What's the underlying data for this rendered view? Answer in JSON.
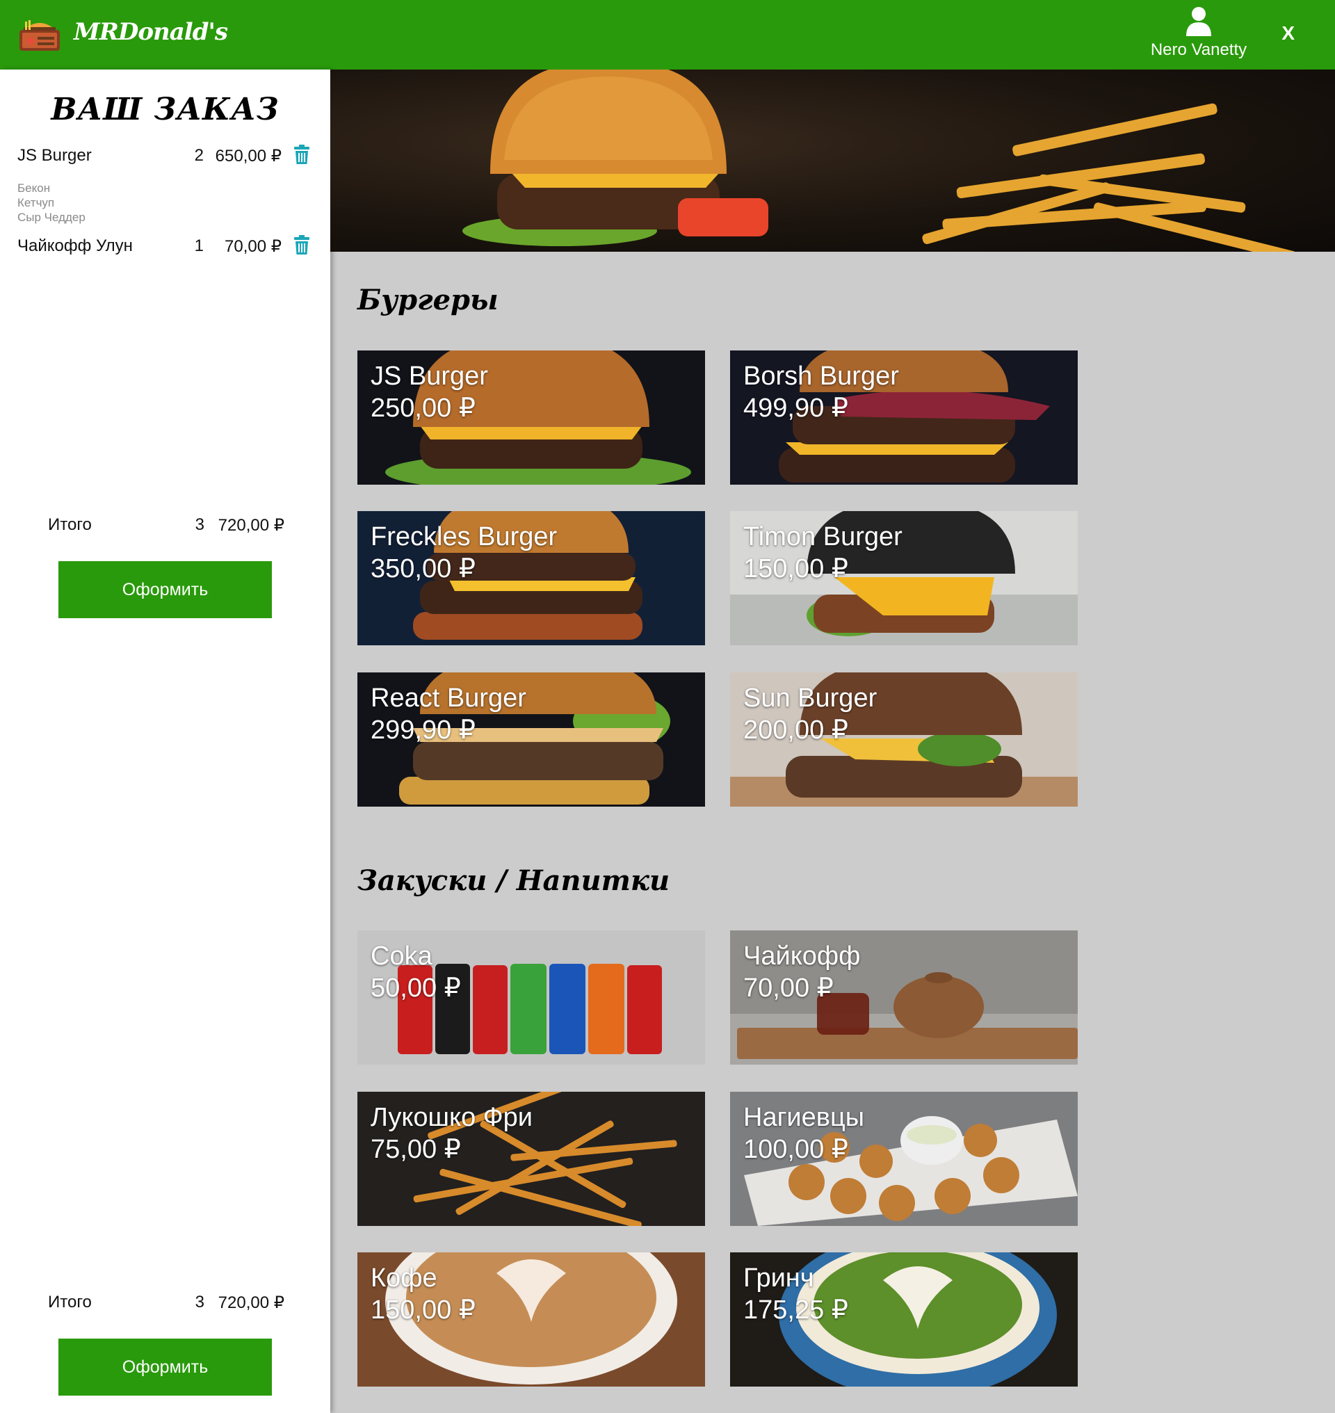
{
  "app": {
    "brand": "MRDonald's",
    "accent_color": "#299a0b",
    "user_name": "Nero Vanetty",
    "close_label": "X"
  },
  "order": {
    "title": "ВАШ ЗАКАЗ",
    "items": [
      {
        "name": "JS Burger",
        "qty": "2",
        "price": "650,00 ₽",
        "toppings": [
          "Бекон",
          "Кетчуп",
          "Сыр Чеддер"
        ]
      },
      {
        "name": "Чайкофф Улун",
        "qty": "1",
        "price": "70,00 ₽",
        "toppings": []
      }
    ],
    "total_label": "Итого",
    "total_count": "3",
    "total_sum": "720,00 ₽",
    "checkout_label": "Оформить"
  },
  "menu": {
    "sections": [
      {
        "title": "Бургеры",
        "items": [
          {
            "name": "JS Burger",
            "price": "250,00 ₽"
          },
          {
            "name": "Borsh Burger",
            "price": "499,90 ₽"
          },
          {
            "name": "Freckles Burger",
            "price": "350,00 ₽"
          },
          {
            "name": "Timon Burger",
            "price": "150,00 ₽"
          },
          {
            "name": "React Burger",
            "price": "299,90 ₽"
          },
          {
            "name": "Sun Burger",
            "price": "200,00 ₽"
          }
        ]
      },
      {
        "title": "Закуски / Напитки",
        "items": [
          {
            "name": "Coka",
            "price": "50,00 ₽"
          },
          {
            "name": "Чайкофф",
            "price": "70,00 ₽"
          },
          {
            "name": "Лукошко Фри",
            "price": "75,00 ₽"
          },
          {
            "name": "Нагиевцы",
            "price": "100,00 ₽"
          },
          {
            "name": "Кофе",
            "price": "150,00 ₽"
          },
          {
            "name": "Гринч",
            "price": "175,25 ₽"
          }
        ]
      }
    ]
  }
}
